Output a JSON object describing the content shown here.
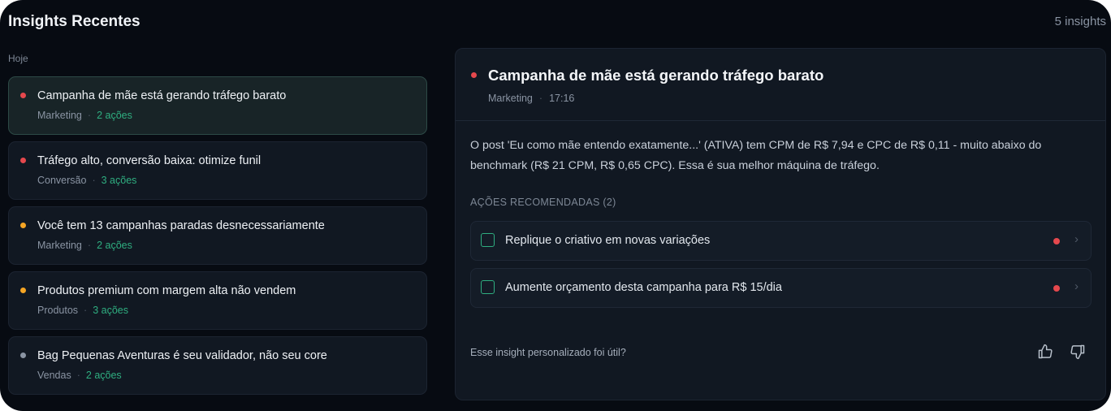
{
  "header": {
    "title": "Insights Recentes",
    "count": "5 insights"
  },
  "list": {
    "day_label": "Hoje",
    "items": [
      {
        "title": "Campanha de mãe está gerando tráfego barato",
        "category": "Marketing",
        "actions": "2 ações",
        "priority_color": "#e5484d",
        "active": true
      },
      {
        "title": "Tráfego alto, conversão baixa: otimize funil",
        "category": "Conversão",
        "actions": "3 ações",
        "priority_color": "#e5484d",
        "active": false
      },
      {
        "title": "Você tem 13 campanhas paradas desnecessariamente",
        "category": "Marketing",
        "actions": "2 ações",
        "priority_color": "#f5a524",
        "active": false
      },
      {
        "title": "Produtos premium com margem alta não vendem",
        "category": "Produtos",
        "actions": "3 ações",
        "priority_color": "#f5a524",
        "active": false
      },
      {
        "title": "Bag Pequenas Aventuras é seu validador, não seu core",
        "category": "Vendas",
        "actions": "2 ações",
        "priority_color": "#8a94a3",
        "active": false
      }
    ],
    "separator": "·"
  },
  "detail": {
    "title": "Campanha de mãe está gerando tráfego barato",
    "category": "Marketing",
    "time": "17:16",
    "separator": "·",
    "priority_color": "#e5484d",
    "body": "O post 'Eu como mãe entendo exatamente...' (ATIVA) tem CPM de R$ 7,94 e CPC de R$ 0,11 - muito abaixo do benchmark (R$ 21 CPM, R$ 0,65 CPC). Essa é sua melhor máquina de tráfego.",
    "section_label": "AÇÕES RECOMENDADAS (2)",
    "actions": [
      {
        "label": "Replique o criativo em novas variações",
        "priority_color": "#e5484d",
        "icon": "chevron-right-icon"
      },
      {
        "label": "Aumente orçamento desta campanha para R$ 15/dia",
        "priority_color": "#e5484d",
        "icon": "chevron-right-icon"
      }
    ],
    "feedback_prompt": "Esse insight personalizado foi útil?",
    "feedback_icons": [
      "thumbs-up-icon",
      "thumbs-down-icon"
    ]
  },
  "colors": {
    "background": "#070b12",
    "card": "#111822",
    "accent": "#2fae80"
  }
}
